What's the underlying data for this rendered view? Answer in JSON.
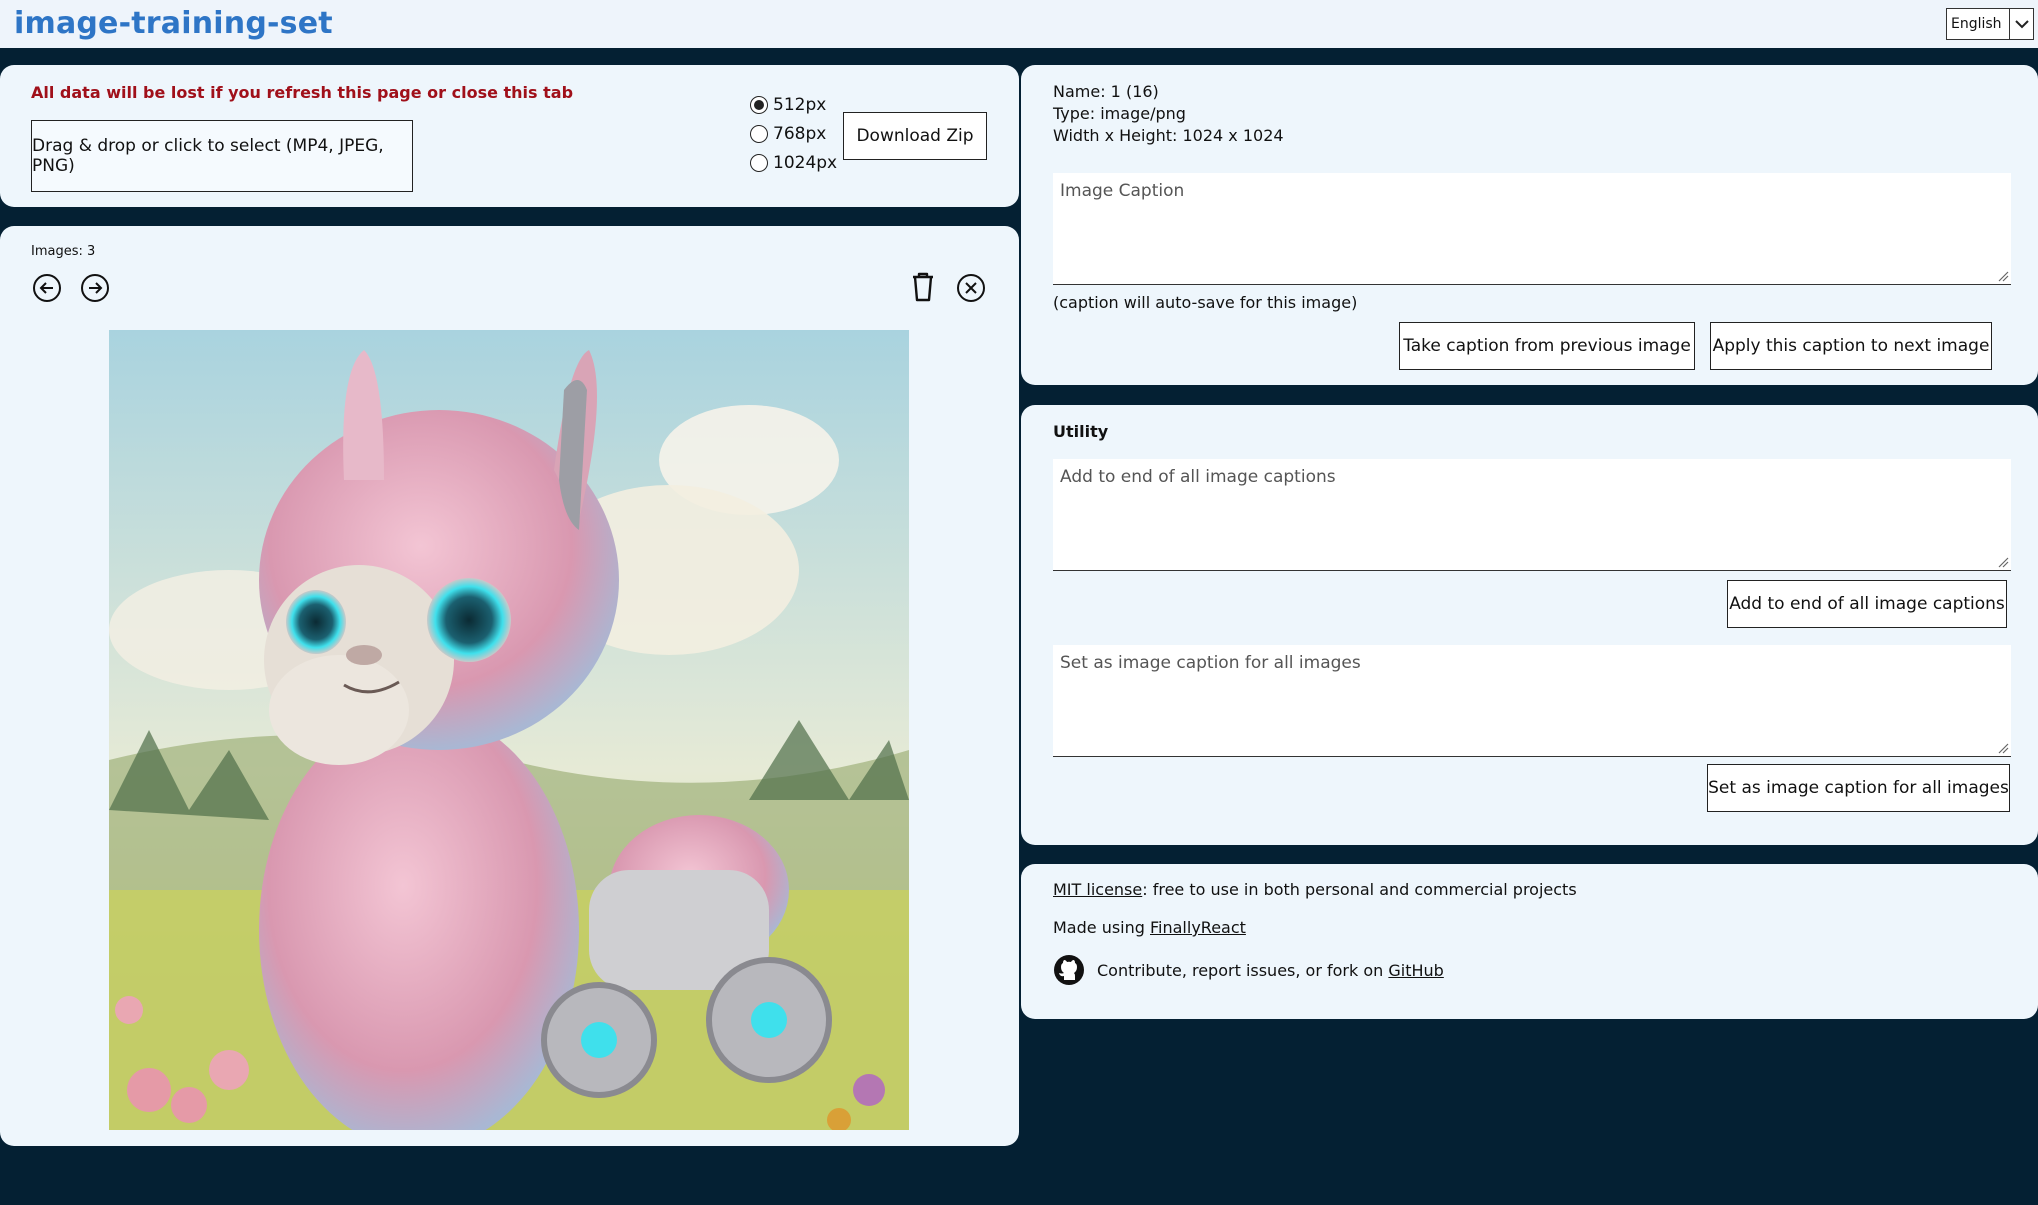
{
  "header": {
    "title": "image-training-set",
    "language": "English"
  },
  "upload": {
    "warning": "All data will be lost if you refresh this page or close this tab",
    "dropzone_label": "Drag & drop or click to select (MP4, JPEG, PNG)",
    "sizes": [
      {
        "label": "512px",
        "selected": true
      },
      {
        "label": "768px",
        "selected": false
      },
      {
        "label": "1024px",
        "selected": false
      }
    ],
    "download_label": "Download Zip"
  },
  "viewer": {
    "images_count": "Images: 3"
  },
  "image_info": {
    "name": "Name: 1 (16)",
    "type": "Type: image/png",
    "dimensions": "Width x Height: 1024 x 1024",
    "caption_placeholder": "Image Caption",
    "autosave_note": "(caption will auto-save for this image)",
    "take_prev_label": "Take caption from previous image",
    "apply_next_label": "Apply this caption to next image"
  },
  "utility": {
    "title": "Utility",
    "append_placeholder": "Add to end of all image captions",
    "append_button": "Add to end of all image captions",
    "set_all_placeholder": "Set as image caption for all images",
    "set_all_button": "Set as image caption for all images"
  },
  "footer": {
    "license_link": "MIT license",
    "license_text": ": free to use in both personal and commercial projects",
    "made_using_text": "Made using ",
    "made_using_link": "FinallyReact",
    "contribute_text": "Contribute, report issues, or fork on ",
    "github_link": "GitHub"
  },
  "colors": {
    "background": "#042033",
    "panel": "#eef6fc",
    "title": "#2e75c6",
    "warning": "#a0101a"
  }
}
